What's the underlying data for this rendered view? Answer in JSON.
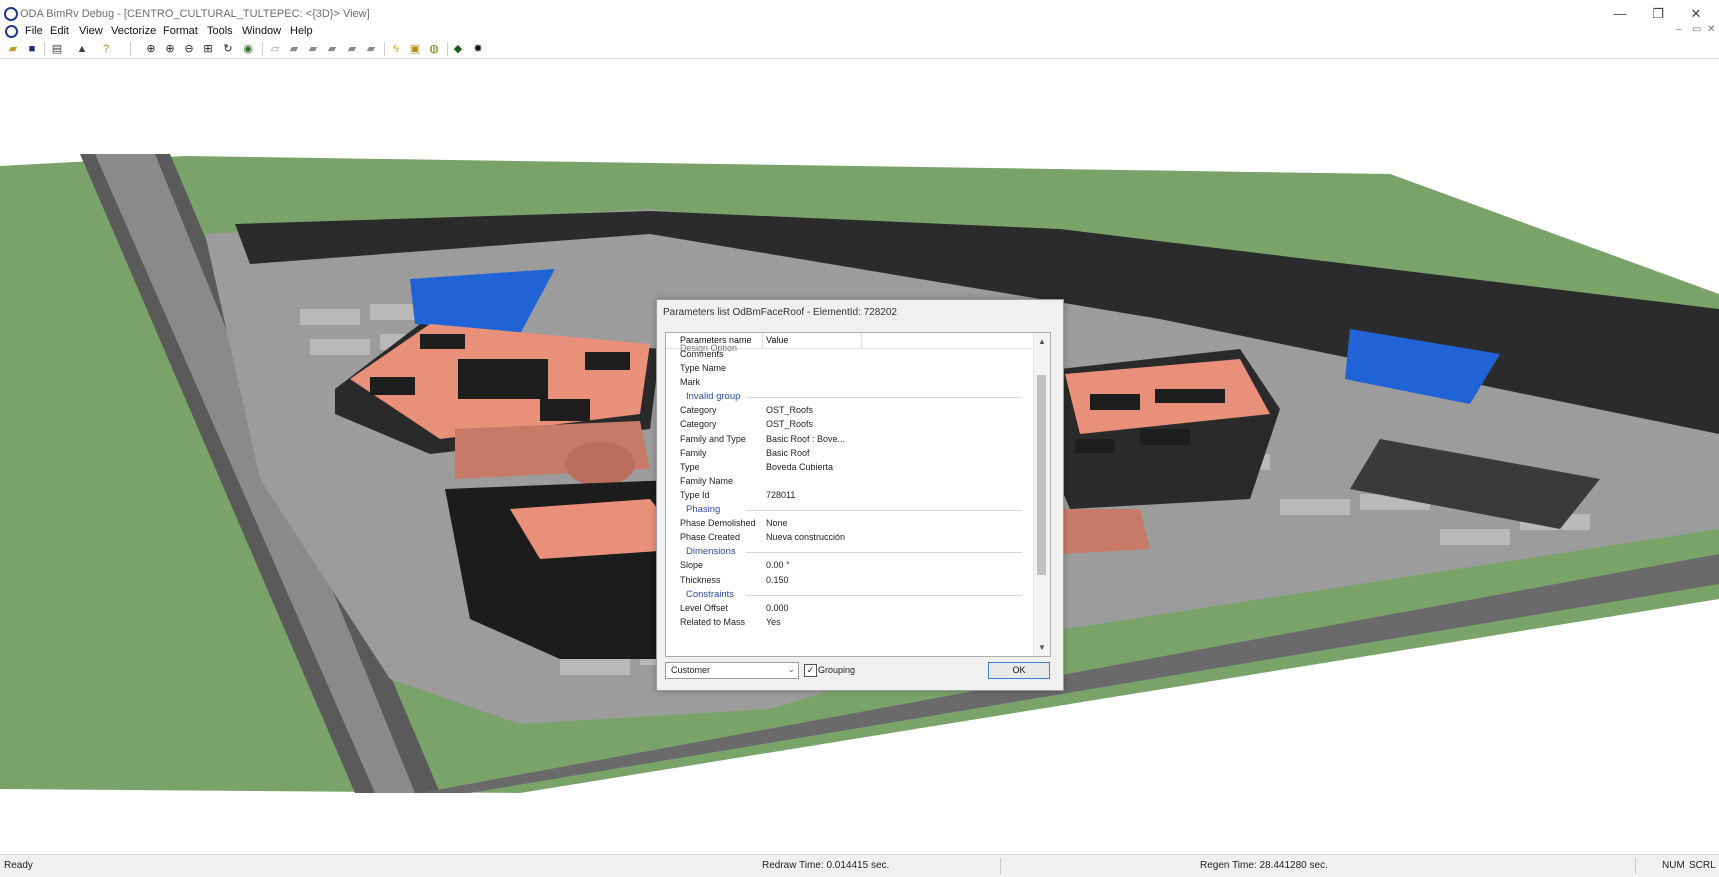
{
  "window": {
    "title": "ODA BimRv Debug - [CENTRO_CULTURAL_TULTEPEC: <{3D}> View]",
    "minimize": "—",
    "maximize": "❐",
    "close": "✕"
  },
  "menu": {
    "items": [
      "File",
      "Edit",
      "View",
      "Vectorize",
      "Format",
      "Tools",
      "Window",
      "Help"
    ],
    "mdi_minimize": "–",
    "mdi_restore": "▭",
    "mdi_close": "✕"
  },
  "toolbar": {
    "icons": [
      "open-icon",
      "save-icon",
      "print-icon",
      "print-preview-icon",
      "help-icon",
      "zoom-extents-icon",
      "zoom-in-icon",
      "zoom-out-icon",
      "zoom-window-icon",
      "orbit-icon",
      "eye-icon",
      "wireframe-icon",
      "hidden-line-icon",
      "flat-shaded-icon",
      "gouraud-icon",
      "flat-edges-icon",
      "gouraud-edges-icon",
      "lightning-icon",
      "picture-icon",
      "look-icon",
      "render-icon",
      "settings-icon"
    ]
  },
  "dialog": {
    "title": "Parameters list OdBmFaceRoof - ElementId: 728202",
    "header": {
      "name": "Parameters name",
      "value": "Value"
    },
    "cut_row": "Design Option",
    "rows": [
      {
        "type": "param",
        "name": "Comments",
        "value": ""
      },
      {
        "type": "param",
        "name": "Type Name",
        "value": ""
      },
      {
        "type": "param",
        "name": "Mark",
        "value": ""
      },
      {
        "type": "group",
        "name": "Invalid group"
      },
      {
        "type": "param",
        "name": "Category",
        "value": "OST_Roofs"
      },
      {
        "type": "param",
        "name": "Category",
        "value": "OST_Roofs"
      },
      {
        "type": "param",
        "name": "Family and Type",
        "value": "Basic Roof : Bove..."
      },
      {
        "type": "param",
        "name": "Family",
        "value": "Basic Roof"
      },
      {
        "type": "param",
        "name": "Type",
        "value": "Boveda Cubierta"
      },
      {
        "type": "param",
        "name": "Family Name",
        "value": ""
      },
      {
        "type": "param",
        "name": "Type Id",
        "value": "728011"
      },
      {
        "type": "group",
        "name": "Phasing"
      },
      {
        "type": "param",
        "name": "Phase Demolished",
        "value": "None"
      },
      {
        "type": "param",
        "name": "Phase Created",
        "value": "Nueva construcción"
      },
      {
        "type": "group",
        "name": "Dimensions"
      },
      {
        "type": "param",
        "name": "Slope",
        "value": "0.00 °"
      },
      {
        "type": "param",
        "name": "Thickness",
        "value": "0.150"
      },
      {
        "type": "group",
        "name": "Constraints"
      },
      {
        "type": "param",
        "name": "Level Offset",
        "value": "0.000"
      },
      {
        "type": "param",
        "name": "Related to Mass",
        "value": "Yes"
      }
    ],
    "combo_value": "Customer",
    "grouping_label": "Grouping",
    "grouping_checked": true,
    "check_mark": "✓",
    "ok_label": "OK"
  },
  "status": {
    "ready": "Ready",
    "redraw": "Redraw Time: 0.014415 sec.",
    "regen": "Regen Time: 28.441280 sec.",
    "num": "NUM",
    "scrl": "SCRL"
  }
}
